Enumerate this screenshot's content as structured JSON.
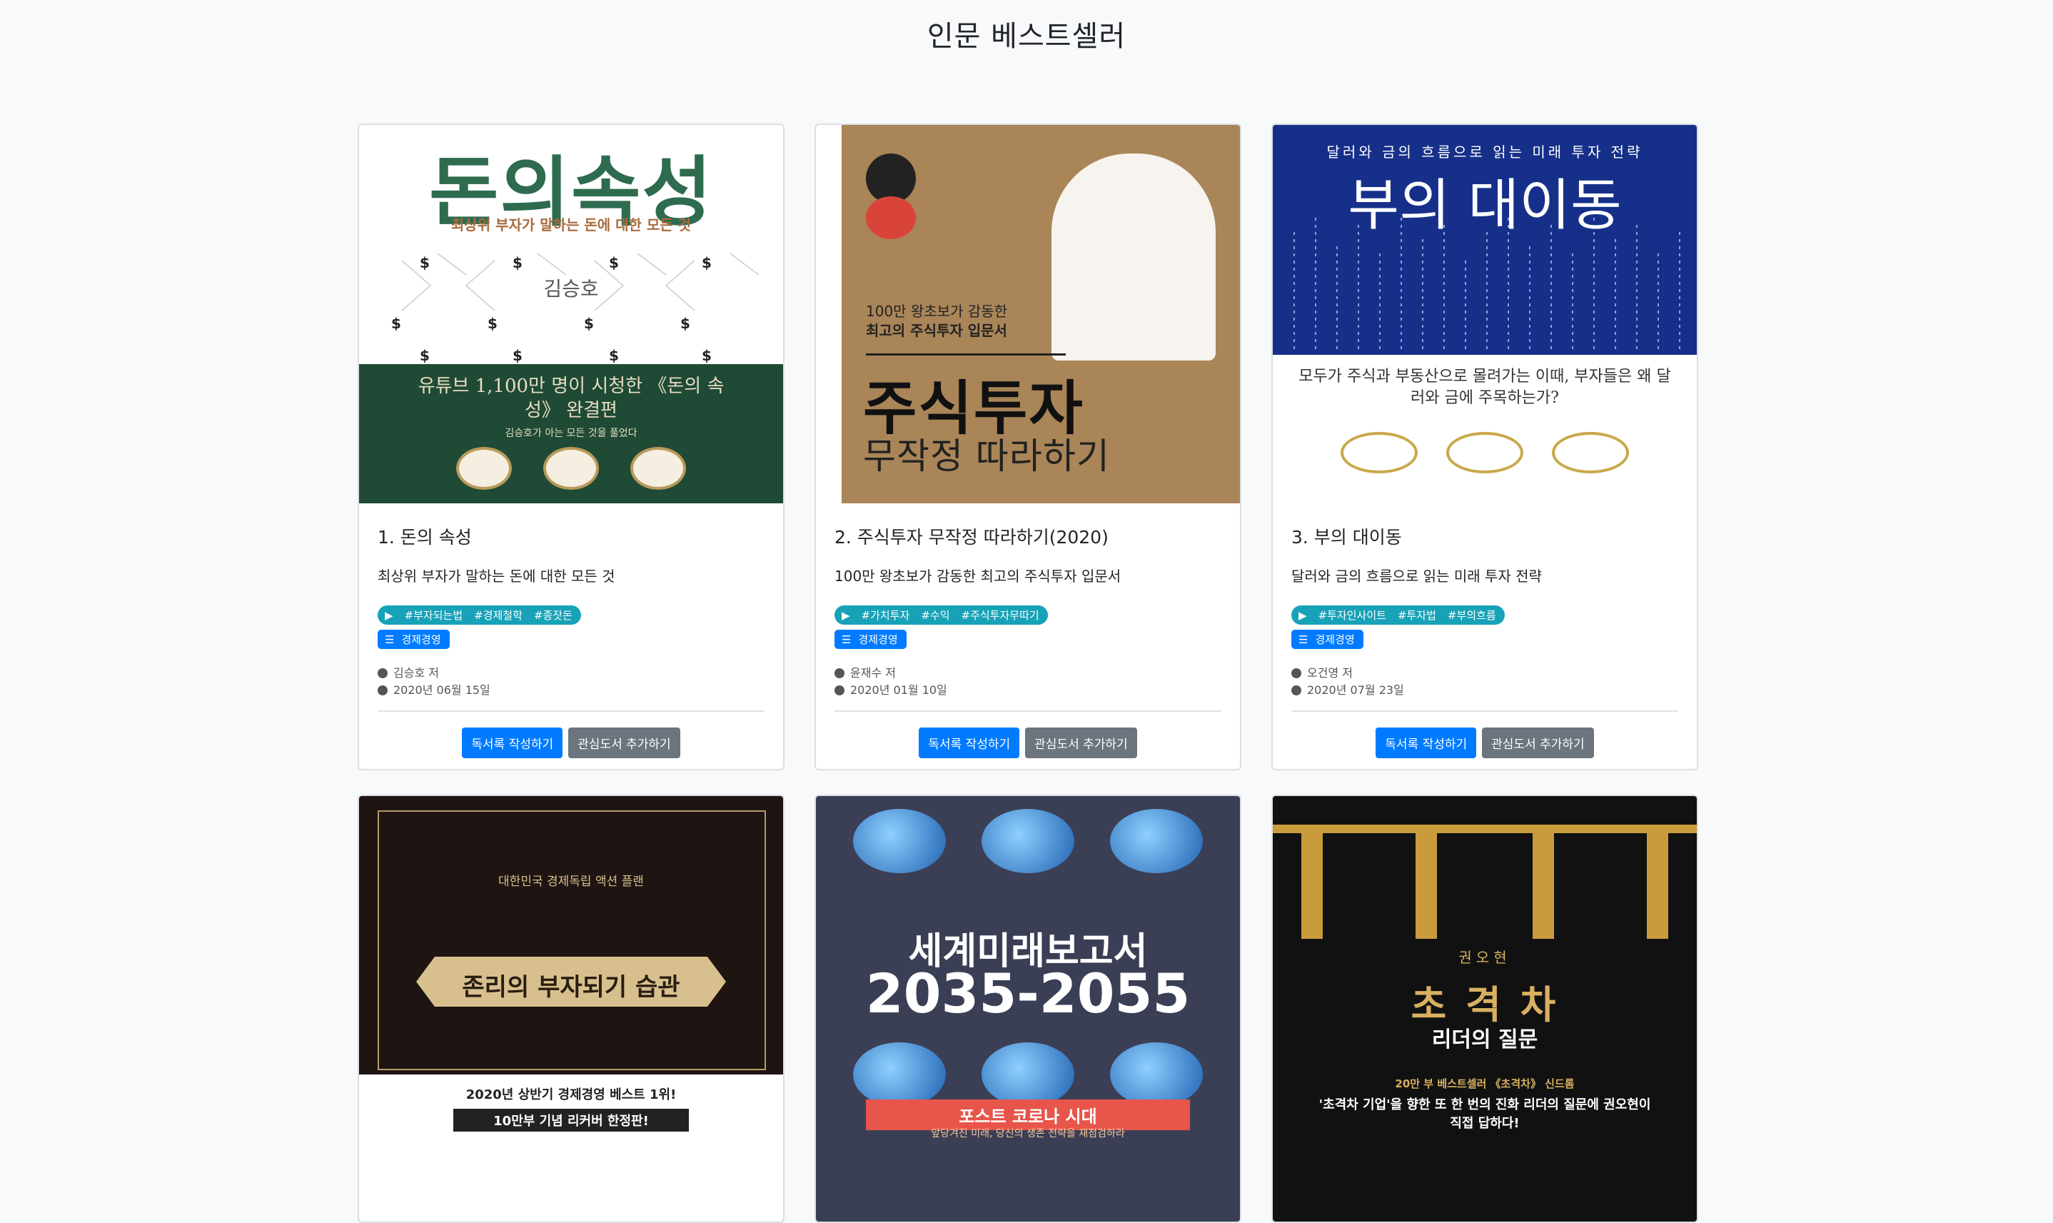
{
  "page": {
    "title": "인문 베스트셀러"
  },
  "colors": {
    "primary": "#007bff",
    "secondary": "#6c757d",
    "info": "#17a2b8"
  },
  "actions": {
    "review_label": "독서록 작성하기",
    "wishlist_label": "관심도서 추가하기"
  },
  "books": [
    {
      "title": "1. 돈의 속성",
      "subtitle": "최상위 부자가 말하는 돈에 대한 모든 것",
      "tags": [
        "#부자되는법",
        "#경제철학",
        "#종잣돈"
      ],
      "category": "경제경영",
      "author": "김승호 저",
      "date": "2020년 06월 15일",
      "cover": {
        "headline": "돈의속성",
        "sub": "최상위 부자가 말하는 돈에 대한 모든 것",
        "author": "김승호",
        "band": "유튜브 1,100만 명이 시청한 《돈의 속성》 완결편",
        "band_sub": "김승호가 아는 모든 것을 풀었다"
      }
    },
    {
      "title": "2. 주식투자 무작정 따라하기(2020)",
      "subtitle": "100만 왕초보가 감동한 최고의 주식투자 입문서",
      "tags": [
        "#가치투자",
        "#수익",
        "#주식투자무따기"
      ],
      "category": "경제경영",
      "author": "윤재수 저",
      "date": "2020년 01월 10일",
      "cover": {
        "top": "100만 왕초보가 감동한",
        "mid": "최고의 주식투자 입문서",
        "headline": "주식투자",
        "sub": "무작정 따라하기"
      }
    },
    {
      "title": "3. 부의 대이동",
      "subtitle": "달러와 금의 흐름으로 읽는 미래 투자 전략",
      "tags": [
        "#투자인사이트",
        "#투자법",
        "#부의흐름"
      ],
      "category": "경제경영",
      "author": "오건영 저",
      "date": "2020년 07월 23일",
      "cover": {
        "top": "달러와 금의 흐름으로 읽는 미래 투자 전략",
        "headline": "부의 대이동",
        "band": "모두가 주식과 부동산으로 몰려가는 이때, 부자들은 왜 달러와 금에 주목하는가?"
      }
    },
    {
      "cover": {
        "top": "대한민국 경제독립 액션 플랜",
        "headline": "존리의 부자되기 습관",
        "band": "2020년 상반기 경제경영 베스트 1위!",
        "band_sub": "10만부 기념 리커버 한정판!"
      }
    },
    {
      "cover": {
        "headline": "세계미래보고서",
        "year": "2035-2055",
        "band": "포스트 코로나 시대",
        "band_sub": "앞당겨진 미래, 당신의 생존 전략을 재점검하라"
      }
    },
    {
      "cover": {
        "author": "권오현",
        "headline": "초 격 차",
        "sub": "리더의 질문",
        "band": "20만 부 베스트셀러 《초격차》 신드롬",
        "band_sub": "'초격차 기업'을 향한 또 한 번의 진화 리더의 질문에 권오현이 직접 답하다!"
      }
    }
  ]
}
